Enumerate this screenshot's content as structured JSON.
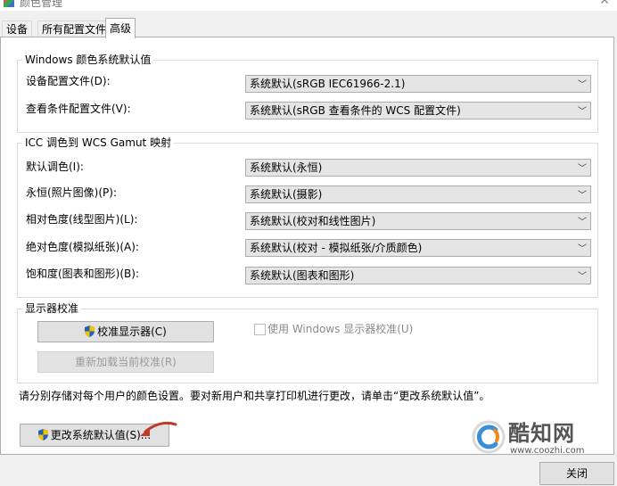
{
  "window": {
    "title": "颜色管理",
    "close_glyph": "✕"
  },
  "tabs": [
    {
      "label": "设备"
    },
    {
      "label": "所有配置文件"
    },
    {
      "label": "高级"
    }
  ],
  "windows_defaults": {
    "legend": "Windows 颜色系统默认值",
    "rows": [
      {
        "label": "设备配置文件(D):",
        "value": "系统默认(sRGB IEC61966-2.1)"
      },
      {
        "label": "查看条件配置文件(V):",
        "value": "系统默认(sRGB 查看条件的 WCS 配置文件)"
      }
    ]
  },
  "icc_mapping": {
    "legend": "ICC 调色到 WCS Gamut 映射",
    "rows": [
      {
        "label": "默认调色(I):",
        "value": "系统默认(永恒)"
      },
      {
        "label": "永恒(照片图像)(P):",
        "value": "系统默认(摄影)"
      },
      {
        "label": "相对色度(线型图片)(L):",
        "value": "系统默认(校对和线性图片)"
      },
      {
        "label": "绝对色度(模拟纸张)(A):",
        "value": "系统默认(校对 - 模拟纸张/介质颜色)"
      },
      {
        "label": "饱和度(图表和图形)(B):",
        "value": "系统默认(图表和图形)"
      }
    ]
  },
  "calibration": {
    "legend": "显示器校准",
    "calibrate_button": "校准显示器(C)",
    "reload_button": "重新加载当前校准(R)",
    "use_windows_checkbox": "使用 Windows 显示器校准(U)",
    "use_windows_checked": false
  },
  "info_text": "请分别存储对每个用户的颜色设置。要对新用户和共享打印机进行更改，请单击“更改系统默认值”。",
  "change_defaults_button": "更改系统默认值(S)...",
  "close_button": "关闭",
  "watermark": {
    "brand": "酷知网",
    "url": "www.coozhi.com"
  },
  "colors": {
    "arrow": "#c0392b",
    "shield_blue": "#1f5fbf",
    "shield_yellow": "#f3c200"
  }
}
